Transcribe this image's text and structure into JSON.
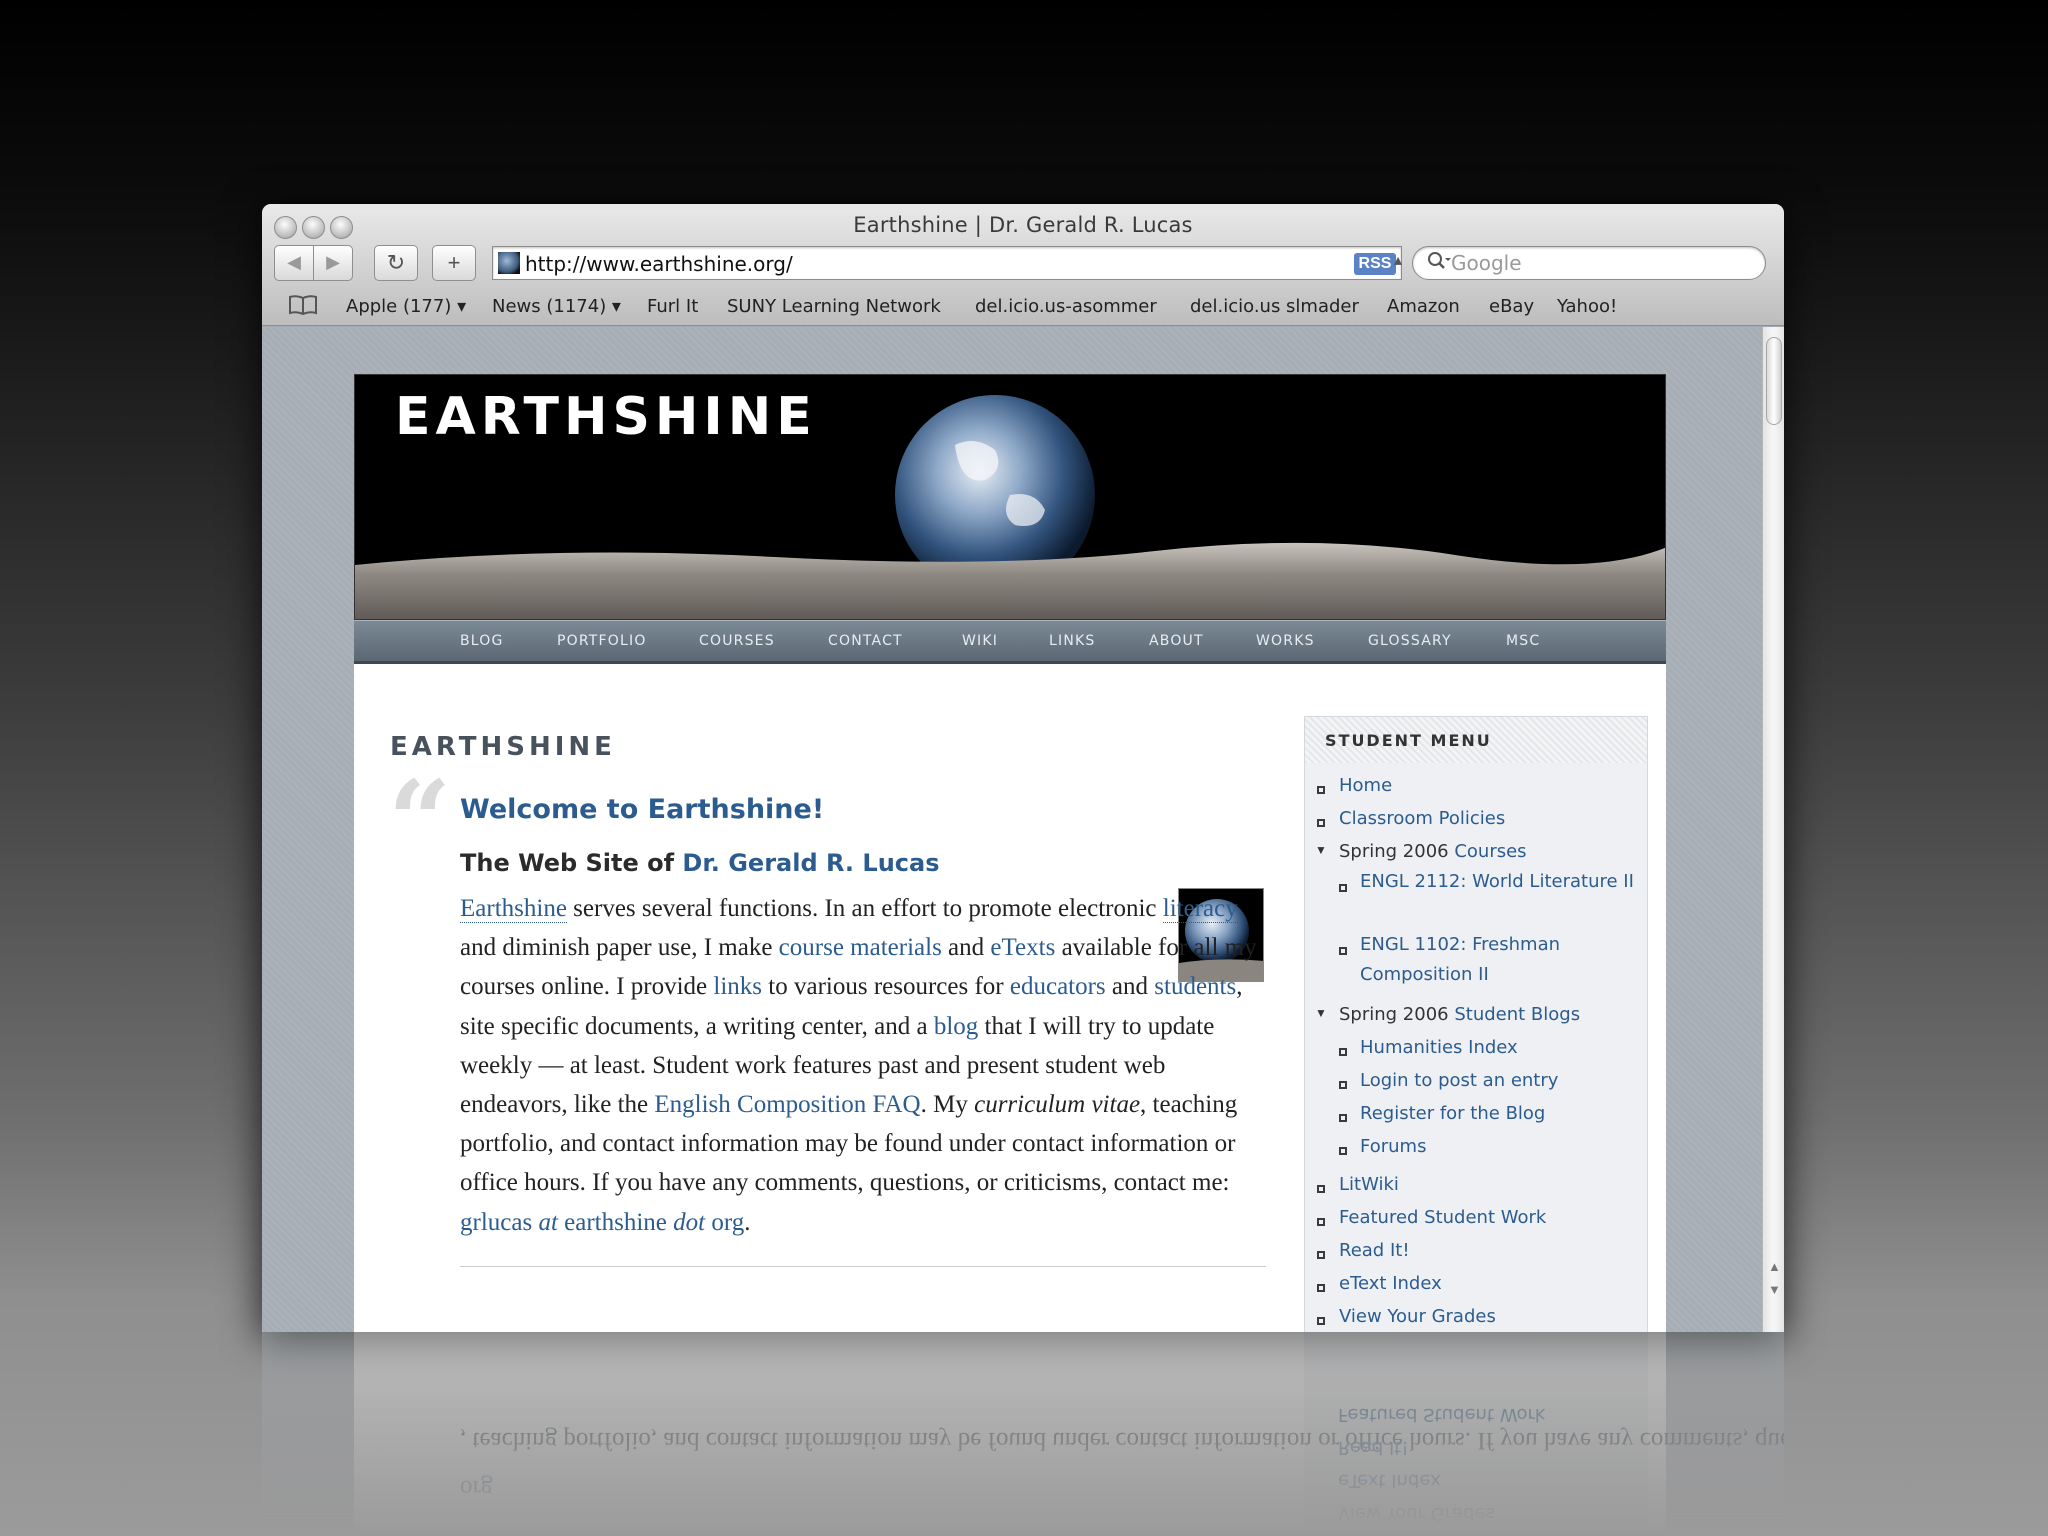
{
  "window": {
    "title": "Earthshine | Dr. Gerald R. Lucas",
    "url": "http://www.earthshine.org/",
    "rss_label": "RSS",
    "search_placeholder": "Google"
  },
  "toolbar": {
    "back_label": "◀",
    "forward_label": "▶",
    "reload_label": "↻",
    "add_label": "+"
  },
  "bookmarks": [
    {
      "label": "Apple (177) ▾"
    },
    {
      "label": "News (1174) ▾"
    },
    {
      "label": "Furl It"
    },
    {
      "label": "SUNY Learning Network"
    },
    {
      "label": "del.icio.us-asommer"
    },
    {
      "label": "del.icio.us slmader"
    },
    {
      "label": "Amazon"
    },
    {
      "label": "eBay"
    },
    {
      "label": "Yahoo!"
    }
  ],
  "site": {
    "logo": "EARTHSHINE",
    "nav": [
      "BLOG",
      "PORTFOLIO",
      "COURSES",
      "CONTACT",
      "WIKI",
      "LINKS",
      "ABOUT",
      "WORKS",
      "GLOSSARY",
      "MSC"
    ],
    "heading": "EARTHSHINE",
    "quote_mark": "“",
    "welcome": "Welcome to Earthshine!",
    "subtitle_prefix": "The Web Site of ",
    "subtitle_link": "Dr. Gerald R. Lucas",
    "body": {
      "earthshine": "Earthshine",
      "t1": " serves several functions. In an effort to promote electronic ",
      "literacy": "literacy",
      "t2": " and diminish paper use, I make ",
      "course_materials": "course materials",
      "t3": " and ",
      "etexts": "eTexts",
      "t4": " available for all my courses online. I provide ",
      "links": "links",
      "t5": " to various resources for ",
      "educators": "educators",
      "t6": " and ",
      "students": "students",
      "t7": ", site specific documents, a writing center, and a ",
      "blog": "blog",
      "t8": " that I will try to update weekly — at least. Student work features past and present student web endeavors, like the ",
      "faq": "English Composition FAQ",
      "t9": ". My ",
      "cv": "curriculum vitae",
      "t10": ", teaching portfolio, and contact information may be found under contact information or office hours. If you have any comments, questions, or criticisms, contact me: ",
      "email_1": "grlucas ",
      "email_at": "at",
      "email_2": " earthshine ",
      "email_dot": "dot",
      "email_3": " org",
      "t11": "."
    }
  },
  "sidebar": {
    "title": "STUDENT MENU",
    "home": "Home",
    "classroom_policies": "Classroom Policies",
    "spring_courses_prefix": "Spring 2006 ",
    "spring_courses_link": "Courses",
    "engl2112": "ENGL 2112: World Literature II",
    "engl1102": "ENGL 1102: Freshman Composition II",
    "spring_blogs_prefix": "Spring 2006 ",
    "spring_blogs_link": "Student Blogs",
    "humanities_index": "Humanities Index",
    "login": "Login to post an entry",
    "register": "Register for the Blog",
    "forums": "Forums",
    "litwiki": "LitWiki",
    "featured": "Featured Student Work",
    "read_it": "Read It!",
    "etext_index": "eText Index",
    "grades": "View Your Grades"
  },
  "colors": {
    "link": "#2c5c8f",
    "heading": "#48525d",
    "nav_bar": "#5b6873"
  },
  "icons": [
    "close-button",
    "minimize-button",
    "zoom-button",
    "bookmarks-book-icon",
    "search-icon",
    "favicon-earth-icon"
  ]
}
